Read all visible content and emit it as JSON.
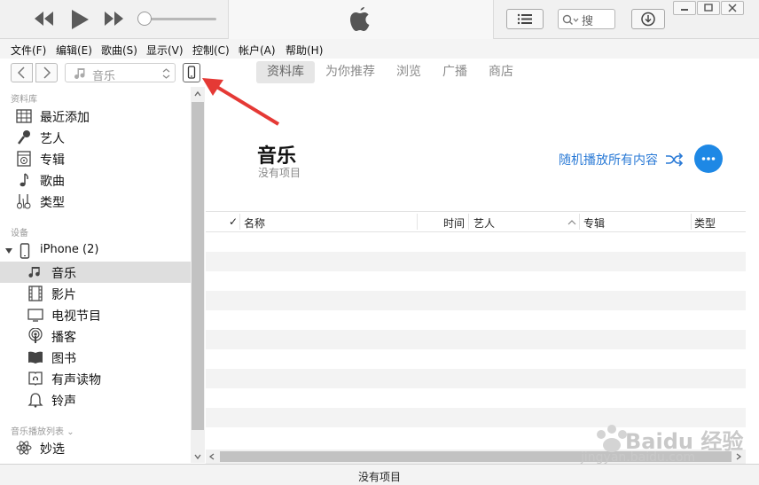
{
  "player": {
    "prev_icon": "rewind-icon",
    "play_icon": "play-icon",
    "next_icon": "fast-forward-icon",
    "volume_level": 0.0,
    "search_placeholder": "搜",
    "list_icon": "list-icon",
    "download_icon": "download-icon"
  },
  "menu": [
    {
      "label": "文件(F)"
    },
    {
      "label": "编辑(E)"
    },
    {
      "label": "歌曲(S)"
    },
    {
      "label": "显示(V)"
    },
    {
      "label": "控制(C)"
    },
    {
      "label": "帐户(A)"
    },
    {
      "label": "帮助(H)"
    }
  ],
  "nav": {
    "media_kind": "音乐",
    "tabs": [
      {
        "label": "资料库",
        "active": true
      },
      {
        "label": "为你推荐"
      },
      {
        "label": "浏览"
      },
      {
        "label": "广播"
      },
      {
        "label": "商店"
      }
    ]
  },
  "sidebar": {
    "library_heading": "资料库",
    "library": [
      {
        "label": "最近添加",
        "icon": "grid-icon"
      },
      {
        "label": "艺人",
        "icon": "microphone-icon"
      },
      {
        "label": "专辑",
        "icon": "album-icon"
      },
      {
        "label": "歌曲",
        "icon": "music-note-icon"
      },
      {
        "label": "类型",
        "icon": "genre-icon"
      }
    ],
    "devices_heading": "设备",
    "device_name": "iPhone (2)",
    "device_items": [
      {
        "label": "音乐",
        "icon": "music-note-icon",
        "selected": true
      },
      {
        "label": "影片",
        "icon": "film-icon"
      },
      {
        "label": "电视节目",
        "icon": "tv-icon"
      },
      {
        "label": "播客",
        "icon": "podcast-icon"
      },
      {
        "label": "图书",
        "icon": "book-icon"
      },
      {
        "label": "有声读物",
        "icon": "audiobook-icon"
      },
      {
        "label": "铃声",
        "icon": "bell-icon"
      }
    ],
    "playlists_heading": "音乐播放列表",
    "playlists": [
      {
        "label": "妙选",
        "icon": "genius-icon"
      }
    ]
  },
  "main": {
    "title": "音乐",
    "subtitle": "没有项目",
    "shuffle_label": "随机播放所有内容",
    "columns": {
      "check": "✓",
      "name": "名称",
      "time": "时间",
      "artist": "艺人",
      "album": "专辑",
      "genre": "类型"
    }
  },
  "status": {
    "text": "没有项目"
  },
  "watermark": {
    "brand": "Baidu 经验",
    "url": "jingyan.baidu.com"
  },
  "colors": {
    "accent": "#1e88e5",
    "link": "#2a7ad6",
    "annotation": "#e53935"
  }
}
